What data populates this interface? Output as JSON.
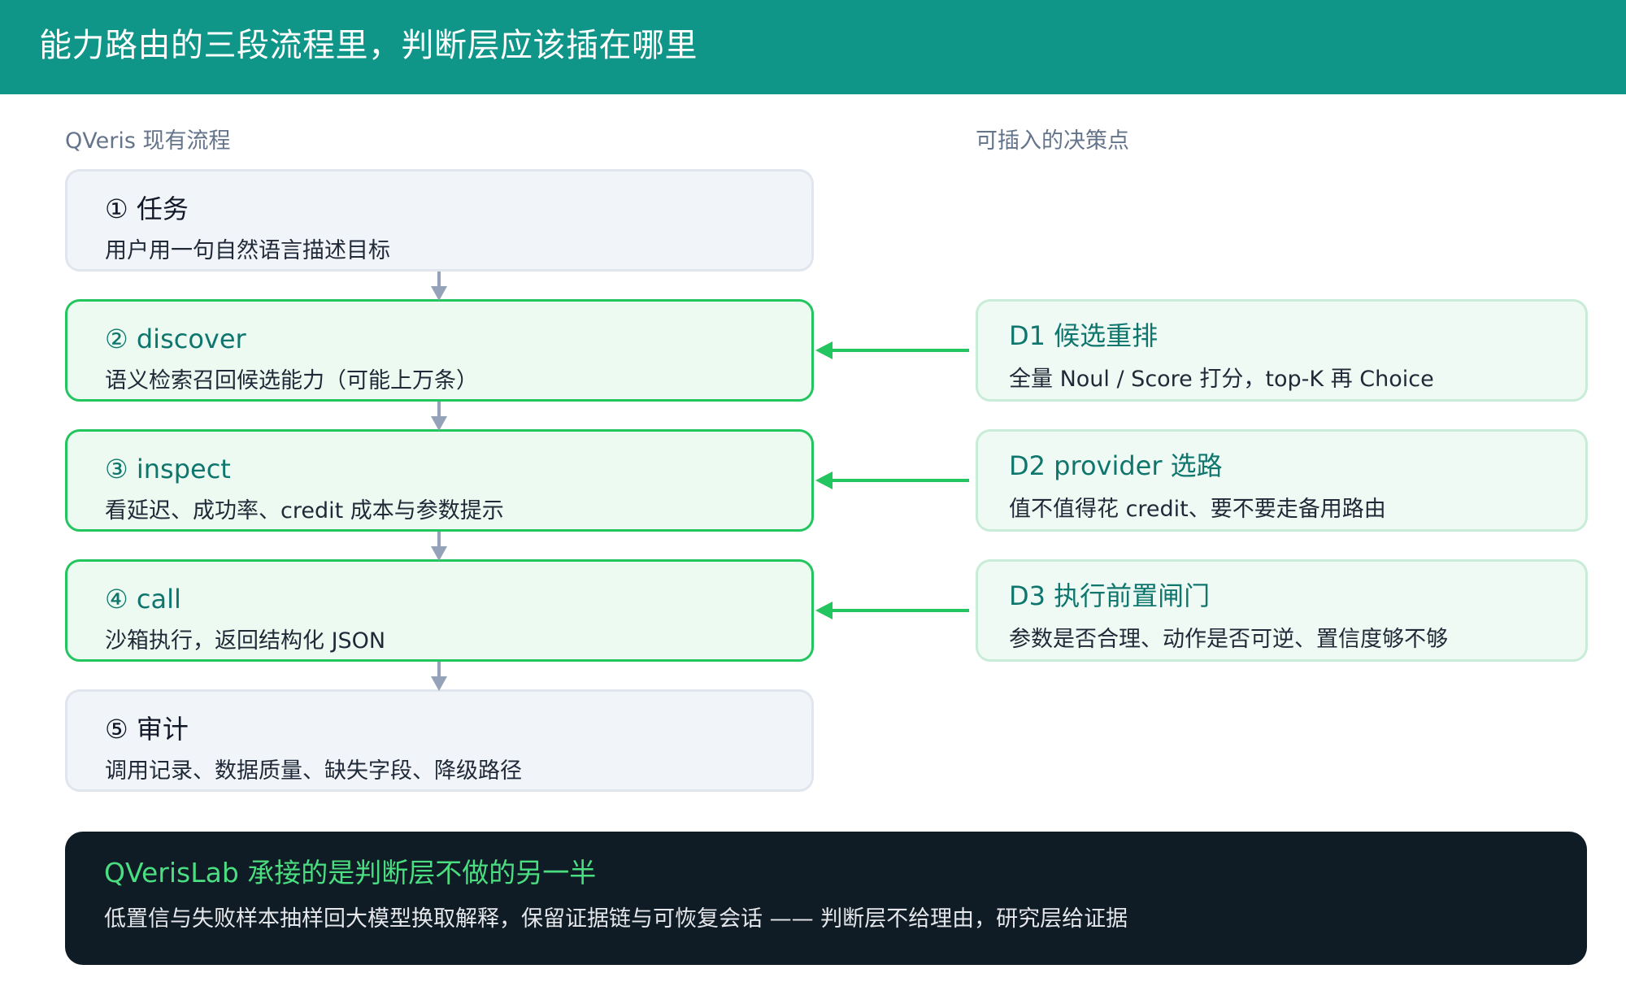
{
  "header": {
    "title": "能力路由的三段流程里，判断层应该插在哪里"
  },
  "left_column": {
    "label": "QVeris 现有流程"
  },
  "right_column": {
    "label": "可插入的决策点"
  },
  "steps": [
    {
      "title": "① 任务",
      "desc": "用户用一句自然语言描述目标",
      "highlight": false
    },
    {
      "title": "② discover",
      "desc": "语义检索召回候选能力（可能上万条）",
      "highlight": true
    },
    {
      "title": "③ inspect",
      "desc": "看延迟、成功率、credit 成本与参数提示",
      "highlight": true
    },
    {
      "title": "④ call",
      "desc": "沙箱执行，返回结构化 JSON",
      "highlight": true
    },
    {
      "title": "⑤ 审计",
      "desc": "调用记录、数据质量、缺失字段、降级路径",
      "highlight": false
    }
  ],
  "decision_points": [
    {
      "title": "D1 候选重排",
      "desc": "全量 Noul / Score 打分，top-K 再 Choice",
      "target_step": 2
    },
    {
      "title": "D2 provider 选路",
      "desc": "值不值得花 credit、要不要走备用路由",
      "target_step": 3
    },
    {
      "title": "D3 执行前置闸门",
      "desc": "参数是否合理、动作是否可逆、置信度够不够",
      "target_step": 4
    }
  ],
  "footer": {
    "title": "QVerisLab 承接的是判断层不做的另一半",
    "text": "低置信与失败样本抽样回大模型换取解释，保留证据链与可恢复会话 —— 判断层不给理由，研究层给证据"
  },
  "colors": {
    "header_bg": "#0f9688",
    "accent_green": "#22c55e",
    "flow_arrow": "#94a3b8",
    "footer_bg": "#0f1b25",
    "footer_title": "#4ade80"
  }
}
